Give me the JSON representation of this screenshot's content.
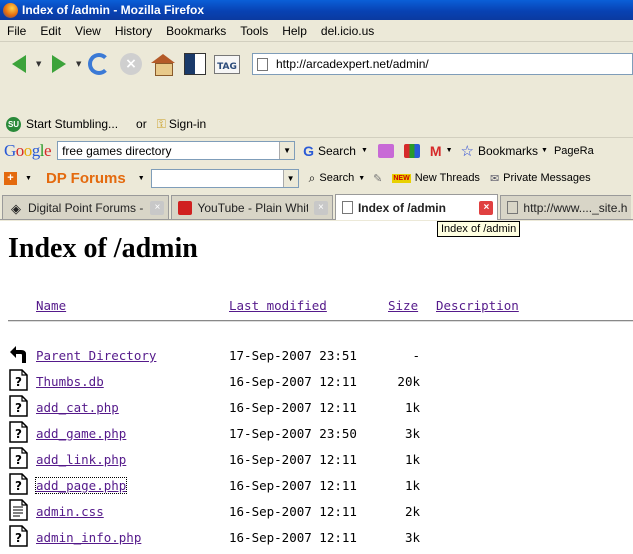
{
  "window": {
    "title": "Index of /admin - Mozilla Firefox"
  },
  "menu": [
    "File",
    "Edit",
    "View",
    "History",
    "Bookmarks",
    "Tools",
    "Help",
    "del.icio.us"
  ],
  "navbar": {
    "url": "http://arcadexpert.net/admin/",
    "tag_label": "TAG"
  },
  "stumble": {
    "start_label": "Start Stumbling...",
    "or_label": "or",
    "signin_label": "Sign-in"
  },
  "googlebar": {
    "query": "free games directory",
    "search_label": "Search",
    "bookmarks_label": "Bookmarks",
    "overflow_label": "PageRa"
  },
  "dpbar": {
    "logo": "DP Forums",
    "search_label": "Search",
    "new_badge": "NEW",
    "new_threads_label": "New Threads",
    "private_messages_label": "Private Messages"
  },
  "tabs": [
    {
      "title": "Digital Point Forums -...",
      "active": false
    },
    {
      "title": "YouTube - Plain Whit...",
      "active": false
    },
    {
      "title": "Index of /admin",
      "active": true
    },
    {
      "title": "http://www...._site.h",
      "active": false
    }
  ],
  "tooltip": "Index of /admin",
  "page": {
    "heading": "Index of /admin",
    "columns": {
      "name": "Name",
      "modified": "Last modified",
      "size": "Size",
      "description": "Description"
    },
    "rows": [
      {
        "name": "Parent Directory",
        "modified": "17-Sep-2007 23:51",
        "size": "-",
        "icon": "back-icon"
      },
      {
        "name": "Thumbs.db",
        "modified": "16-Sep-2007 12:11",
        "size": "20k",
        "icon": "unknown-file-icon"
      },
      {
        "name": "add_cat.php",
        "modified": "16-Sep-2007 12:11",
        "size": "1k",
        "icon": "unknown-file-icon"
      },
      {
        "name": "add_game.php",
        "modified": "17-Sep-2007 23:50",
        "size": "3k",
        "icon": "unknown-file-icon"
      },
      {
        "name": "add_link.php",
        "modified": "16-Sep-2007 12:11",
        "size": "1k",
        "icon": "unknown-file-icon"
      },
      {
        "name": "add_page.php",
        "modified": "16-Sep-2007 12:11",
        "size": "1k",
        "icon": "unknown-file-icon"
      },
      {
        "name": "admin.css",
        "modified": "16-Sep-2007 12:11",
        "size": "2k",
        "icon": "text-file-icon"
      },
      {
        "name": "admin_info.php",
        "modified": "16-Sep-2007 12:11",
        "size": "3k",
        "icon": "unknown-file-icon"
      }
    ]
  }
}
